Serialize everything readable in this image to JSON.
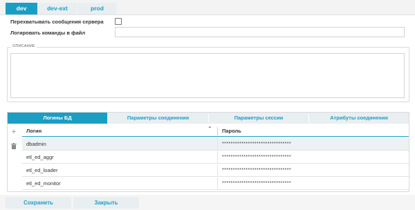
{
  "env_tabs": [
    "dev",
    "dev-ext",
    "prod"
  ],
  "form": {
    "intercept_label": "Перехватывать сообщения сервера",
    "log_label": "Логировать команды в файл",
    "log_value": "",
    "description_legend": "ОПИСАНИЕ",
    "description_value": ""
  },
  "sub_tabs": [
    "Логины БД",
    "Параметры соединения",
    "Параметры сессии",
    "Атрибуты соединения"
  ],
  "grid": {
    "columns": [
      "Логин",
      "Пароль"
    ],
    "rows": [
      {
        "login": "dbadmin",
        "password": "********************************"
      },
      {
        "login": "etl_ed_aggr",
        "password": "********************************"
      },
      {
        "login": "etl_ed_loader",
        "password": "********************************"
      },
      {
        "login": "etl_ed_monitor",
        "password": "********************************"
      }
    ]
  },
  "icons": {
    "add": "plus-icon",
    "delete": "trash-icon",
    "sort": "sort-asc-icon"
  },
  "colors": {
    "accent": "#1a9ec4",
    "tab_bg": "#e9eef0"
  },
  "footer": {
    "save": "Сохранить",
    "close": "Закрыть"
  }
}
